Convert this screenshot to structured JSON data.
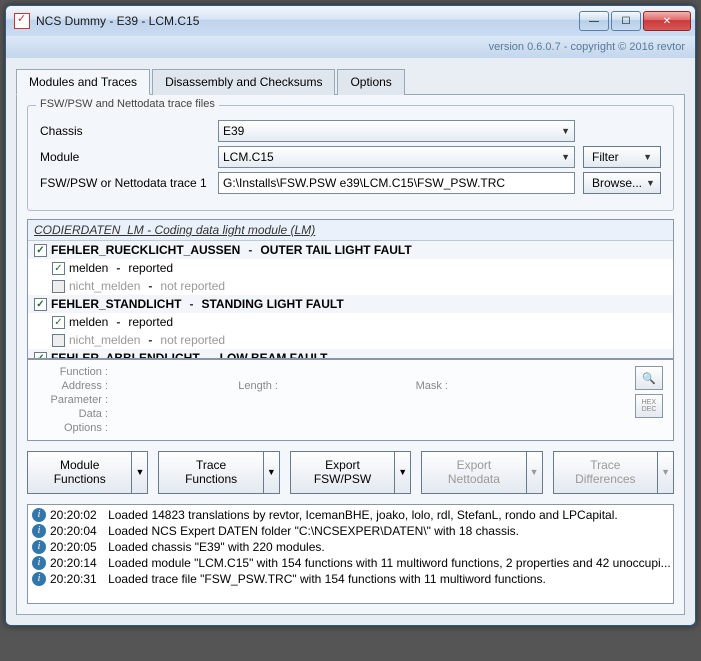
{
  "titlebar": {
    "text": "NCS Dummy - E39 - LCM.C15"
  },
  "menubar": {
    "version": "version 0.6.0.7 - copyright © 2016 revtor"
  },
  "tabs": [
    {
      "label": "Modules and Traces",
      "active": true
    },
    {
      "label": "Disassembly and Checksums",
      "active": false
    },
    {
      "label": "Options",
      "active": false
    }
  ],
  "fieldset": {
    "legend": "FSW/PSW and Nettodata trace files",
    "chassis_label": "Chassis",
    "chassis_value": "E39",
    "module_label": "Module",
    "module_value": "LCM.C15",
    "filter_label": "Filter",
    "trace_label": "FSW/PSW or Nettodata trace 1",
    "trace_value": "G:\\Installs\\FSW.PSW e39\\LCM.C15\\FSW_PSW.TRC",
    "browse_label": "Browse..."
  },
  "grid": {
    "header": "CODIERDATEN_LM  -  Coding data light module (LM)",
    "rows": [
      {
        "type": "parent",
        "checked": true,
        "de": "FEHLER_RUECKLICHT_AUSSEN",
        "en": "OUTER TAIL LIGHT FAULT"
      },
      {
        "type": "child",
        "checked": true,
        "de": "melden",
        "en": "reported"
      },
      {
        "type": "child-disabled",
        "checked": false,
        "de": "nicht_melden",
        "en": "not reported"
      },
      {
        "type": "parent",
        "checked": true,
        "de": "FEHLER_STANDLICHT",
        "en": "STANDING LIGHT FAULT"
      },
      {
        "type": "child",
        "checked": true,
        "de": "melden",
        "en": "reported"
      },
      {
        "type": "child-disabled",
        "checked": false,
        "de": "nicht_melden",
        "en": "not reported"
      },
      {
        "type": "parent",
        "checked": true,
        "de": "FEHLER_ABBLENDLICHT",
        "en": "LOW BEAM FAULT"
      }
    ]
  },
  "detail": {
    "function": "Function :",
    "address": "Address :",
    "length": "Length :",
    "mask": "Mask :",
    "parameter": "Parameter :",
    "data": "Data :",
    "options": "Options :",
    "hexdec": "HEX\nDEC"
  },
  "actions": {
    "module_functions": "Module\nFunctions",
    "trace_functions": "Trace\nFunctions",
    "export_fsw": "Export\nFSW/PSW",
    "export_netto": "Export\nNettodata",
    "trace_diff": "Trace\nDifferences"
  },
  "log": [
    {
      "time": "20:20:02",
      "msg": "Loaded 14823 translations by revtor, IcemanBHE, joako, lolo, rdl, StefanL, rondo and LPCapital."
    },
    {
      "time": "20:20:04",
      "msg": "Loaded NCS Expert DATEN folder \"C:\\NCSEXPER\\DATEN\\\" with 18 chassis."
    },
    {
      "time": "20:20:05",
      "msg": "Loaded chassis \"E39\" with 220 modules."
    },
    {
      "time": "20:20:14",
      "msg": "Loaded module \"LCM.C15\" with 154 functions with 11 multiword functions, 2 properties and 42 unoccupi..."
    },
    {
      "time": "20:20:31",
      "msg": "Loaded trace file \"FSW_PSW.TRC\" with 154 functions with 11 multiword functions."
    }
  ]
}
